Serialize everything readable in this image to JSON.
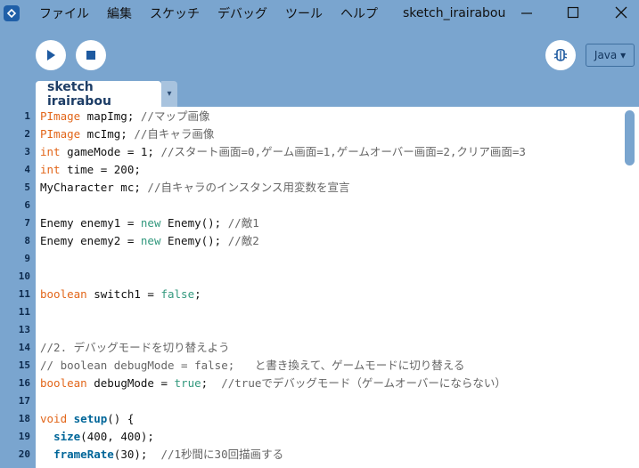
{
  "menu": {
    "items": [
      "ファイル",
      "編集",
      "スケッチ",
      "デバッグ",
      "ツール",
      "ヘルプ"
    ],
    "window_title": "sketch_irairabou"
  },
  "toolbar": {
    "run_icon": "play-icon",
    "stop_icon": "stop-icon",
    "debugger_icon": "bug-icon",
    "mode_label": "Java ▾"
  },
  "tab": {
    "label": "sketch irairabou",
    "menu_arrow": "▾"
  },
  "editor": {
    "lines": [
      {
        "num": "1",
        "segments": [
          {
            "t": "PImage",
            "c": "kw"
          },
          {
            "t": " mapImg; ",
            "c": ""
          },
          {
            "t": "//マップ画像",
            "c": "cm"
          }
        ]
      },
      {
        "num": "2",
        "segments": [
          {
            "t": "PImage",
            "c": "kw"
          },
          {
            "t": " mcImg; ",
            "c": ""
          },
          {
            "t": "//自キャラ画像",
            "c": "cm"
          }
        ]
      },
      {
        "num": "3",
        "segments": [
          {
            "t": "int",
            "c": "kw"
          },
          {
            "t": " gameMode = 1; ",
            "c": ""
          },
          {
            "t": "//スタート画面=0,ゲーム画面=1,ゲームオーバー画面=2,クリア画面=3",
            "c": "cm"
          }
        ]
      },
      {
        "num": "4",
        "segments": [
          {
            "t": "int",
            "c": "kw"
          },
          {
            "t": " time = 200;",
            "c": ""
          }
        ]
      },
      {
        "num": "5",
        "segments": [
          {
            "t": "MyCharacter mc; ",
            "c": ""
          },
          {
            "t": "//自キャラのインスタンス用変数を宣言",
            "c": "cm"
          }
        ]
      },
      {
        "num": "6",
        "segments": []
      },
      {
        "num": "7",
        "segments": [
          {
            "t": "Enemy enemy1 = ",
            "c": ""
          },
          {
            "t": "new",
            "c": "kw2"
          },
          {
            "t": " Enemy(); ",
            "c": ""
          },
          {
            "t": "//敵1",
            "c": "cm"
          }
        ]
      },
      {
        "num": "8",
        "segments": [
          {
            "t": "Enemy enemy2 = ",
            "c": ""
          },
          {
            "t": "new",
            "c": "kw2"
          },
          {
            "t": " Enemy(); ",
            "c": ""
          },
          {
            "t": "//敵2",
            "c": "cm"
          }
        ]
      },
      {
        "num": "9",
        "segments": []
      },
      {
        "num": "10",
        "segments": []
      },
      {
        "num": "11",
        "segments": [
          {
            "t": "boolean",
            "c": "kw"
          },
          {
            "t": " switch1 = ",
            "c": ""
          },
          {
            "t": "false",
            "c": "kw2"
          },
          {
            "t": ";",
            "c": ""
          }
        ]
      },
      {
        "num": "11",
        "segments": []
      },
      {
        "num": "13",
        "segments": []
      },
      {
        "num": "14",
        "segments": [
          {
            "t": "//2. デバッグモードを切り替えよう",
            "c": "cm"
          }
        ]
      },
      {
        "num": "15",
        "segments": [
          {
            "t": "// boolean debugMode = false;   と書き換えて、ゲームモードに切り替える",
            "c": "cm"
          }
        ]
      },
      {
        "num": "16",
        "segments": [
          {
            "t": "boolean",
            "c": "kw"
          },
          {
            "t": " debugMode = ",
            "c": ""
          },
          {
            "t": "true",
            "c": "kw2"
          },
          {
            "t": ";  ",
            "c": ""
          },
          {
            "t": "//trueでデバッグモード（ゲームオーバーにならない）",
            "c": "cm"
          }
        ]
      },
      {
        "num": "17",
        "segments": []
      },
      {
        "num": "18",
        "segments": [
          {
            "t": "void",
            "c": "kw"
          },
          {
            "t": " ",
            "c": ""
          },
          {
            "t": "setup",
            "c": "fn"
          },
          {
            "t": "() {",
            "c": ""
          }
        ]
      },
      {
        "num": "19",
        "segments": [
          {
            "t": "  ",
            "c": ""
          },
          {
            "t": "size",
            "c": "fn"
          },
          {
            "t": "(400, 400);",
            "c": ""
          }
        ]
      },
      {
        "num": "20",
        "segments": [
          {
            "t": "  ",
            "c": ""
          },
          {
            "t": "frameRate",
            "c": "fn"
          },
          {
            "t": "(30);  ",
            "c": ""
          },
          {
            "t": "//1秒間に30回描画する",
            "c": "cm"
          }
        ]
      }
    ]
  }
}
